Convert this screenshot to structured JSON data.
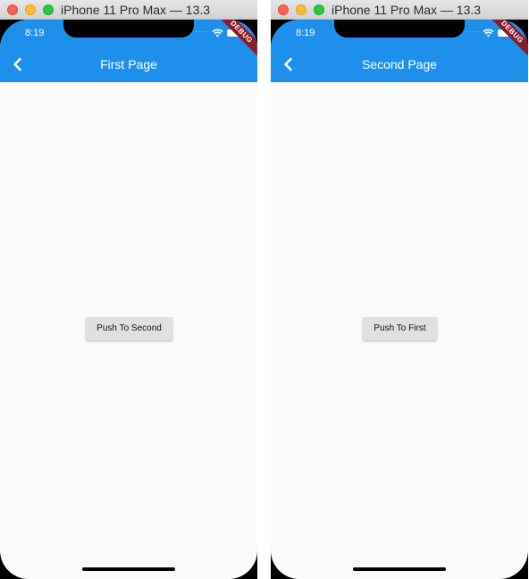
{
  "simulators": [
    {
      "window_title": "iPhone 11 Pro Max — 13.3",
      "status_bar": {
        "time": "8:19",
        "dots": "····"
      },
      "debug_banner": "DEBUG",
      "appbar": {
        "title": "First Page"
      },
      "button": {
        "label": "Push To Second"
      }
    },
    {
      "window_title": "iPhone 11 Pro Max — 13.3",
      "status_bar": {
        "time": "8:19",
        "dots": "····"
      },
      "debug_banner": "DEBUG",
      "appbar": {
        "title": "Second Page"
      },
      "button": {
        "label": "Push To First"
      }
    }
  ],
  "colors": {
    "appbar": "#1e90ec",
    "page_background": "#fafafa",
    "button_background": "#e0e0e0",
    "debug_banner": "#8b1c2b"
  },
  "icons": {
    "back": "chevron-left-icon",
    "wifi": "wifi-icon",
    "battery": "battery-icon"
  }
}
